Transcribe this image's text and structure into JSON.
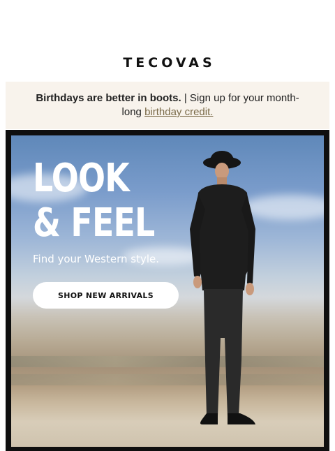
{
  "brand": {
    "logo_text": "TECOVAS"
  },
  "promo": {
    "bold_text": "Birthdays are better in boots.",
    "separator": " | ",
    "text": "Sign up for your month-long ",
    "link_text": "birthday credit."
  },
  "hero": {
    "headline_line1": "LOOK",
    "headline_line2": "& FEEL",
    "subline": "Find your Western style.",
    "cta_label": "SHOP NEW ARRIVALS",
    "image_description_icon": "cowboy-photo"
  },
  "colors": {
    "promo_bg": "#f8f3ec",
    "link": "#7a6a48",
    "hero_frame": "#0f0f0f",
    "cta_bg": "#ffffff"
  }
}
